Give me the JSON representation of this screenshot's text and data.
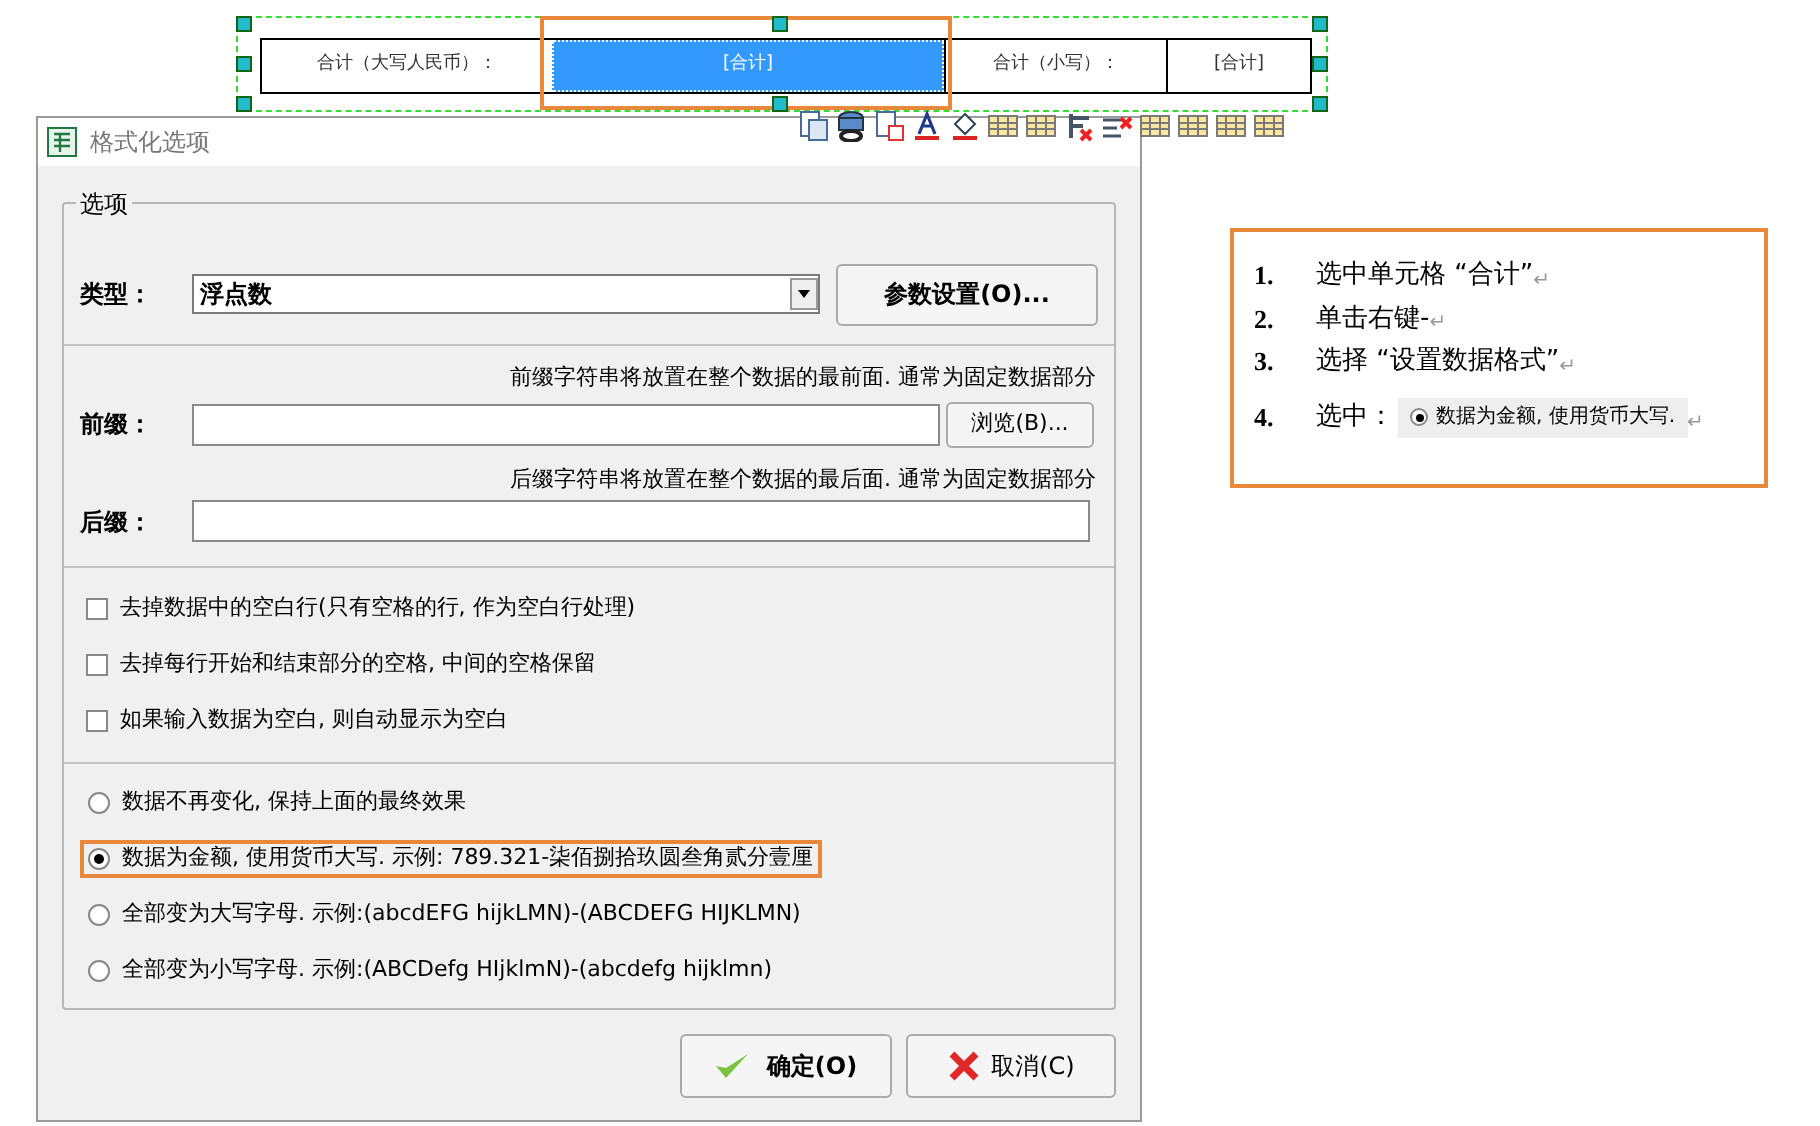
{
  "report_band": {
    "cells": [
      {
        "text": "合计（大写人民币）：",
        "selected": false
      },
      {
        "text": "[合计]",
        "selected": true
      },
      {
        "text": "合计（小写）：",
        "selected": false
      },
      {
        "text": "[合计]",
        "selected": false
      }
    ]
  },
  "dialog": {
    "title": "格式化选项",
    "group_label": "选项",
    "type_label": "类型：",
    "type_value": "浮点数",
    "param_button": "参数设置(O)...",
    "prefix_hint": "前缀字符串将放置在整个数据的最前面. 通常为固定数据部分",
    "prefix_label": "前缀：",
    "browse_button": "浏览(B)...",
    "suffix_hint": "后缀字符串将放置在整个数据的最后面. 通常为固定数据部分",
    "suffix_label": "后缀：",
    "checkboxes": [
      {
        "label": "去掉数据中的空白行(只有空格的行, 作为空白行处理)",
        "checked": false
      },
      {
        "label": "去掉每行开始和结束部分的空格, 中间的空格保留",
        "checked": false
      },
      {
        "label": "如果输入数据为空白, 则自动显示为空白",
        "checked": false
      }
    ],
    "radios": [
      {
        "label": "数据不再变化, 保持上面的最终效果",
        "selected": false,
        "highlighted": false
      },
      {
        "label": "数据为金额, 使用货币大写. 示例: 789.321-柒佰捌拾玖圆叁角贰分壹厘",
        "selected": true,
        "highlighted": true
      },
      {
        "label": "全部变为大写字母. 示例:(abcdEFG hijkLMN)-(ABCDEFG HIJKLMN)",
        "selected": false,
        "highlighted": false
      },
      {
        "label": "全部变为小写字母. 示例:(ABCDefg HIjklmN)-(abcdefg hijklmn)",
        "selected": false,
        "highlighted": false
      }
    ],
    "ok_button": "确定(O)",
    "cancel_button": "取消(C)"
  },
  "instructions": {
    "steps": [
      {
        "kind": "text",
        "number": "1.",
        "text": "选中单元格 “合计”",
        "mark": "↵"
      },
      {
        "kind": "text",
        "number": "2.",
        "text": "单击右键-",
        "mark": "↵"
      },
      {
        "kind": "text",
        "number": "3.",
        "text": "选择 “设置数据格式”",
        "mark": "↵"
      },
      {
        "kind": "radio_sample",
        "number": "4.",
        "text": "选中：",
        "sample": "数据为金额, 使用货币大写.",
        "selected": true,
        "mark": "↵"
      }
    ]
  }
}
